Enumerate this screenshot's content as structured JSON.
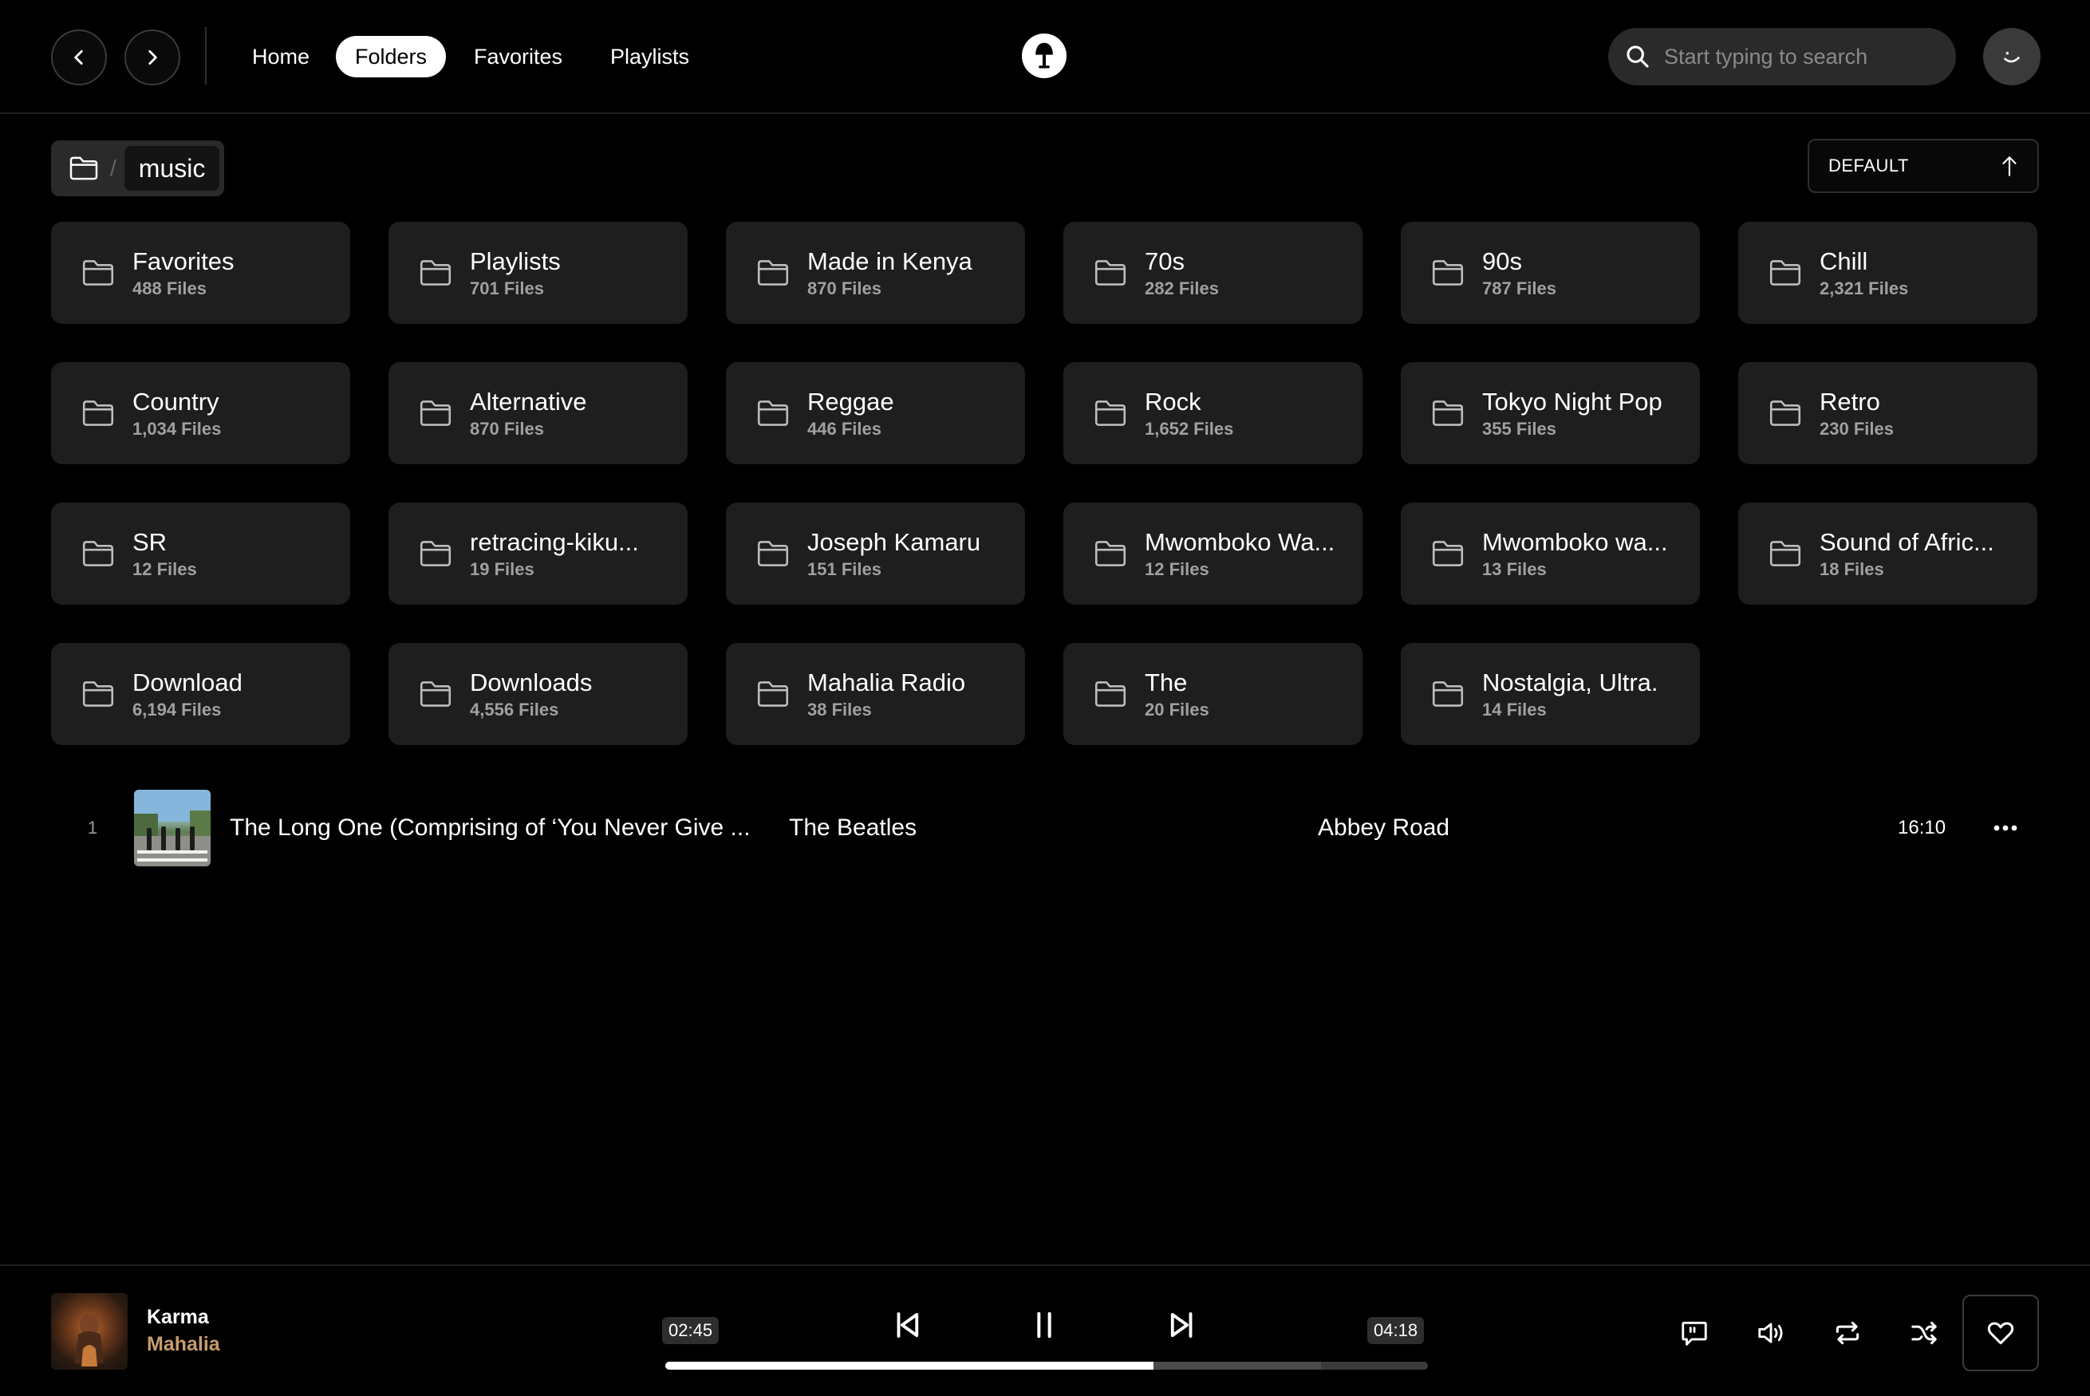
{
  "nav": {
    "links": [
      {
        "label": "Home",
        "active": false
      },
      {
        "label": "Folders",
        "active": true
      },
      {
        "label": "Favorites",
        "active": false
      },
      {
        "label": "Playlists",
        "active": false
      }
    ],
    "search_placeholder": "Start typing to search"
  },
  "breadcrumb": {
    "separator": "/",
    "current": "music"
  },
  "sort": {
    "label": "DEFAULT",
    "direction_icon": "arrow-up-icon"
  },
  "folders": [
    {
      "name": "Favorites",
      "count": "488 Files"
    },
    {
      "name": "Playlists",
      "count": "701 Files"
    },
    {
      "name": "Made in Kenya",
      "count": "870 Files"
    },
    {
      "name": "70s",
      "count": "282 Files"
    },
    {
      "name": "90s",
      "count": "787 Files"
    },
    {
      "name": "Chill",
      "count": "2,321 Files"
    },
    {
      "name": "Country",
      "count": "1,034 Files"
    },
    {
      "name": "Alternative",
      "count": "870 Files"
    },
    {
      "name": "Reggae",
      "count": "446 Files"
    },
    {
      "name": "Rock",
      "count": "1,652 Files"
    },
    {
      "name": "Tokyo Night Pop",
      "count": "355 Files"
    },
    {
      "name": "Retro",
      "count": "230 Files"
    },
    {
      "name": "SR",
      "count": "12 Files"
    },
    {
      "name": "retracing-kiku...",
      "count": "19 Files"
    },
    {
      "name": "Joseph Kamaru",
      "count": "151 Files"
    },
    {
      "name": "Mwomboko Wa...",
      "count": "12 Files"
    },
    {
      "name": "Mwomboko wa...",
      "count": "13 Files"
    },
    {
      "name": "Sound of Afric...",
      "count": "18 Files"
    },
    {
      "name": "Download",
      "count": "6,194 Files"
    },
    {
      "name": "Downloads",
      "count": "4,556 Files"
    },
    {
      "name": "Mahalia Radio",
      "count": "38 Files"
    },
    {
      "name": "The",
      "count": "20 Files"
    },
    {
      "name": "Nostalgia, Ultra.",
      "count": "14 Files"
    }
  ],
  "tracks": [
    {
      "index": "1",
      "title": "The Long One (Comprising of ‘You Never Give ...",
      "artist": "The Beatles",
      "album": "Abbey Road",
      "duration": "16:10"
    }
  ],
  "player": {
    "title": "Karma",
    "artist": "Mahalia",
    "elapsed": "02:45",
    "total": "04:18",
    "progress_fraction": 0.64,
    "buffered_fraction": 0.86,
    "artist_color": "#c79c6c"
  }
}
